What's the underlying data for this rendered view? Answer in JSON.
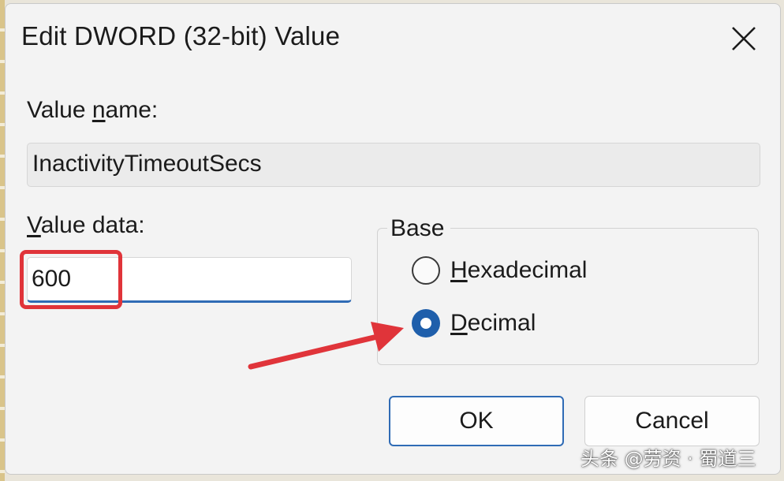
{
  "dialog": {
    "title": "Edit DWORD (32-bit) Value",
    "close_glyph": "close-icon"
  },
  "value_name": {
    "label_underlined": "n",
    "label_pre": "Value ",
    "label_post": "ame:",
    "value": "InactivityTimeoutSecs"
  },
  "value_data": {
    "label_underlined": "V",
    "label_post": "alue data:",
    "value": "600"
  },
  "base": {
    "legend": "Base",
    "options": [
      {
        "underlined": "H",
        "rest": "exadecimal",
        "selected": false
      },
      {
        "underlined": "D",
        "rest": "ecimal",
        "selected": true
      }
    ]
  },
  "buttons": {
    "ok": "OK",
    "cancel": "Cancel"
  },
  "annotation": {
    "highlight_color": "#e0343a",
    "arrow_color": "#e0343a"
  },
  "accent_color": "#1f5fab",
  "watermark": "头条 @劳资 · 蜀道三"
}
